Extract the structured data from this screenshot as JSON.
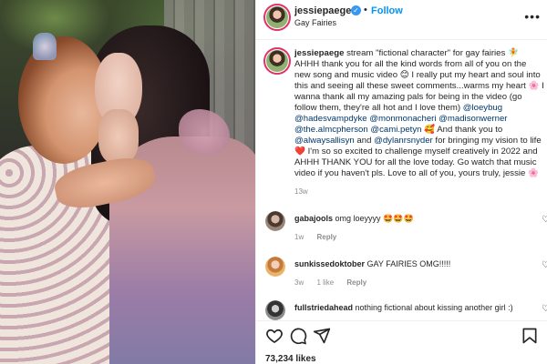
{
  "post": {
    "username": "jessiepaege",
    "follow_label": "Follow",
    "dot": "•",
    "subtitle": "Gay Fairies",
    "more_label": "•••",
    "verified_mark": "✓"
  },
  "caption": {
    "username": "jessiepaege",
    "segments": [
      {
        "t": "stream \"fictional character\" for gay fairies 🧚 AHHH thank you for all the kind words from all of you on the new song and music video 😊 I really put my heart and soul into this and seeing all these sweet comments...warms my heart 🌸 I wanna thank all my amazing pals for being in the video (go follow them, they're all hot and I love them) "
      },
      {
        "t": "@loeybug",
        "m": true
      },
      {
        "t": " "
      },
      {
        "t": "@hadesvampdyke",
        "m": true
      },
      {
        "t": " "
      },
      {
        "t": "@monmonacheri",
        "m": true
      },
      {
        "t": " "
      },
      {
        "t": "@madisonwerner",
        "m": true
      },
      {
        "t": " "
      },
      {
        "t": "@the.almcpherson",
        "m": true
      },
      {
        "t": " "
      },
      {
        "t": "@cami.petyn",
        "m": true
      },
      {
        "t": " 🥰 And thank you to "
      },
      {
        "t": "@alwaysallisyn",
        "m": true
      },
      {
        "t": " and "
      },
      {
        "t": "@dylanrsnyder",
        "m": true
      },
      {
        "t": " for bringing my vision to life ❤️ I'm so so excited to challenge myself creatively in 2022 and AHHH THANK YOU for all the love today. Go watch that music video if you haven't pls. Love to all of you, yours truly, jessie 🌸"
      }
    ],
    "time": "13w"
  },
  "comments": [
    {
      "username": "gabajools",
      "text": "omg loeyyyy 🤩🤩🤩",
      "time": "1w",
      "likes": "",
      "reply": "Reply",
      "heart": "♡"
    },
    {
      "username": "sunkissedoktober",
      "text": "GAY FAIRIES OMG!!!!!",
      "time": "3w",
      "likes": "1 like",
      "reply": "Reply",
      "heart": "♡"
    },
    {
      "username": "fullstriedahead",
      "text": "nothing fictional about kissing another girl :)",
      "time": "",
      "likes": "",
      "reply": "",
      "heart": "♡"
    }
  ],
  "actions": {
    "icons": [
      "heart-icon",
      "comment-icon",
      "share-icon",
      "bookmark-icon"
    ],
    "likes": "73,234 likes"
  },
  "colors": {
    "follow": "#0095f6",
    "mention": "#00376b",
    "verified": "#3897f0"
  }
}
